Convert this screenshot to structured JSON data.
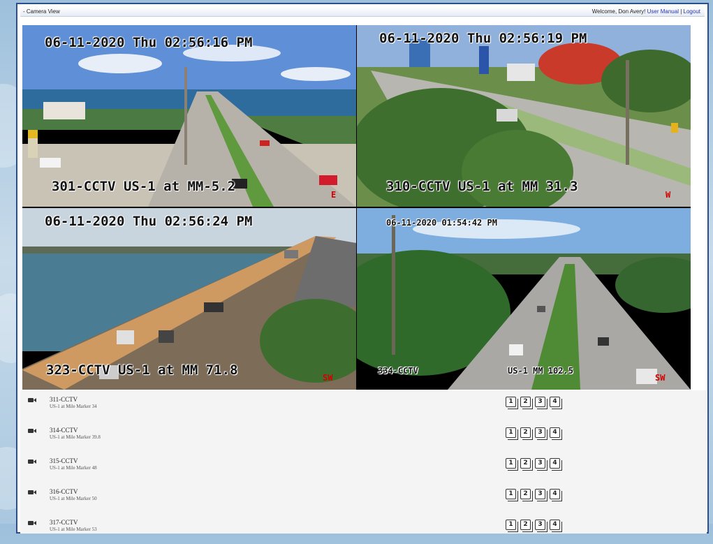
{
  "header": {
    "title": "- Camera View",
    "welcome": "Welcome, Don Avery!",
    "user_manual": "User Manual",
    "separator": "|",
    "logout": "Logout"
  },
  "cameras": [
    {
      "timestamp": "06-11-2020 Thu 02:56:16 PM",
      "label": "301-CCTV  US-1 at MM-5.2",
      "direction": "E"
    },
    {
      "timestamp": "06-11-2020 Thu 02:56:19 PM",
      "label": "310-CCTV  US-1 at MM 31.3",
      "direction": "W"
    },
    {
      "timestamp": "06-11-2020 Thu 02:56:24 PM",
      "label": "323-CCTV  US-1 at MM 71.8",
      "direction": "SW"
    },
    {
      "timestamp": "06-11-2020 01:54:42 PM",
      "label_left": "334-CCTV",
      "label_right": "US-1 MM 102.5",
      "direction": "SW"
    }
  ],
  "camera_list": [
    {
      "name": "311-CCTV",
      "desc": "US-1 at Mile Marker 34"
    },
    {
      "name": "314-CCTV",
      "desc": "US-1 at Mile Marker 39.8"
    },
    {
      "name": "315-CCTV",
      "desc": "US-1 at Mile Marker 48"
    },
    {
      "name": "316-CCTV",
      "desc": "US-1 at Mile Marker 50"
    },
    {
      "name": "317-CCTV",
      "desc": "US-1 at Mile Marker 53"
    }
  ],
  "slot_labels": [
    "1",
    "2",
    "3",
    "4"
  ],
  "icons": {
    "camera": "video-camera-icon"
  },
  "colors": {
    "frame_border": "#2a4f8e",
    "link": "#2233bb",
    "stamp_red": "#d40000"
  }
}
